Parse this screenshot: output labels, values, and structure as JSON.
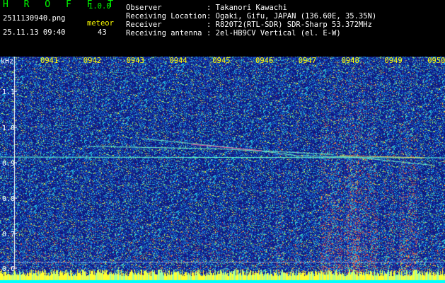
{
  "header": {
    "app_name": "H R O F F T",
    "version": "1.0.0",
    "filename": "2511130940.png",
    "datetime": "25.11.13 09:40",
    "meteor_label": "meteor",
    "meteor_count": "43",
    "info": [
      {
        "label": "Observer",
        "value": ": Takanori Kawachi"
      },
      {
        "label": "Receiving Location",
        "value": ": Ogaki, Gifu, JAPAN (136.60E, 35.35N)"
      },
      {
        "label": "Receiver",
        "value": ": R820T2(RTL-SDR) SDR-Sharp 53.372MHz"
      },
      {
        "label": "Receiving antenna",
        "value": ": 2el-HB9CV Vertical (el. E-W)"
      }
    ]
  },
  "spectrogram": {
    "y_unit": "kHz",
    "y_ticks": [
      "1.1",
      "1.0",
      "0.9",
      "0.8",
      "0.7",
      "0.6"
    ],
    "time_labels": [
      "0941",
      "0942",
      "0943",
      "0944",
      "0945",
      "0946",
      "0947",
      "0948",
      "0949",
      "0950"
    ],
    "colors": {
      "label": "#ffff00",
      "axis": "#ffffff",
      "background": "#0a1a7a"
    }
  }
}
